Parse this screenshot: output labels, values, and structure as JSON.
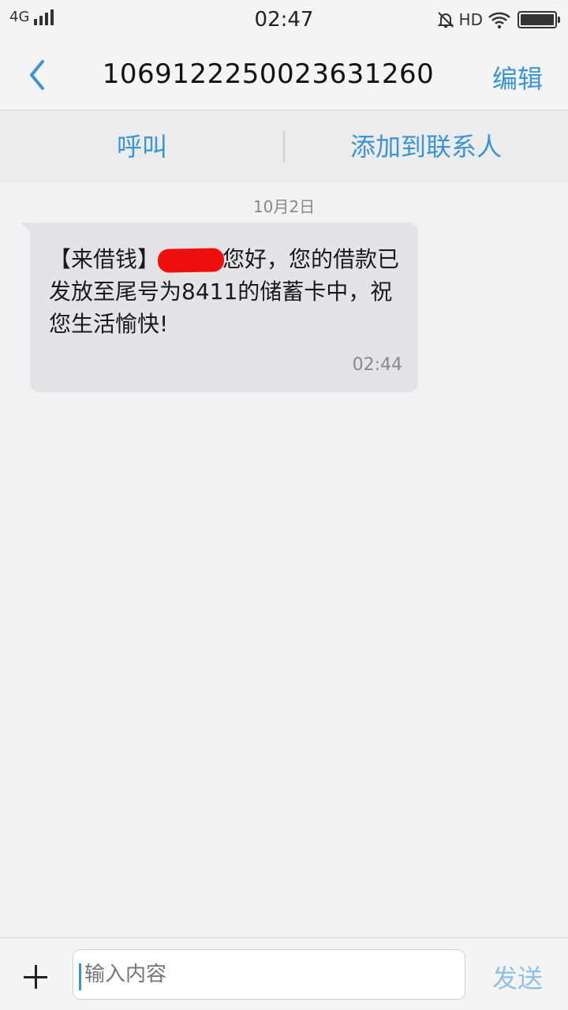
{
  "status_bar": {
    "network": "4G",
    "time": "02:47",
    "hd_label": "HD"
  },
  "header": {
    "title": "1069122250023631260",
    "edit_label": "编辑"
  },
  "actions": {
    "call_label": "呼叫",
    "add_contact_label": "添加到联系人"
  },
  "conversation": {
    "date": "10月2日",
    "messages": [
      {
        "prefix": "【来借钱】",
        "text_rest": "您好，您的借款已发放至尾号为8411的储蓄卡中，祝您生活愉快!",
        "time": "02:44"
      }
    ]
  },
  "input_bar": {
    "placeholder": "输入内容",
    "send_label": "发送"
  },
  "colors": {
    "accent": "#3a95d6",
    "send_disabled": "#8fc1e6",
    "bubble": "#e4e4e6",
    "redaction": "#ef0f0f"
  },
  "icons": [
    "back-chevron-icon",
    "signal-icon",
    "mute-icon",
    "wifi-icon",
    "battery-icon",
    "plus-icon"
  ]
}
